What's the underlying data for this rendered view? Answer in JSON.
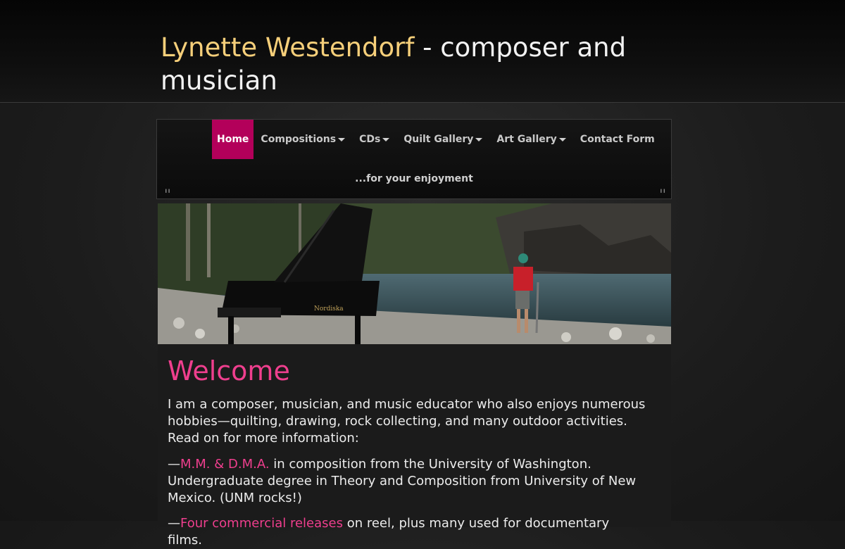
{
  "header": {
    "name": "Lynette Westendorf",
    "rest": " - composer and musician"
  },
  "nav": {
    "items": [
      {
        "label": "Home",
        "dropdown": false,
        "active": true
      },
      {
        "label": "Compositions",
        "dropdown": true
      },
      {
        "label": "CDs",
        "dropdown": true
      },
      {
        "label": "Quilt Gallery",
        "dropdown": true
      },
      {
        "label": "Art Gallery",
        "dropdown": true
      },
      {
        "label": "Contact Form",
        "dropdown": false
      }
    ],
    "sub_item": "...for your enjoyment"
  },
  "hero": {
    "piano_brand": "Nordiska"
  },
  "main": {
    "heading": "Welcome",
    "para1": "I am a composer, musician, and music educator who also enjoys numerous hobbies—quilting, drawing, rock collecting, and many outdoor activities. Read on for more information:",
    "para2_prefix": "—",
    "para2_link": "M.M. & D.M.A.",
    "para2_rest": " in composition from the University of Washington. Undergraduate degree in Theory and Composition from University of New Mexico. (UNM rocks!)",
    "para3_prefix": "—",
    "para3_link": "Four commercial releases",
    "para3_rest": " on reel, plus many used for documentary films."
  },
  "colors": {
    "accent": "#ef3f8e",
    "nav_active": "#b3005a",
    "title_name": "#f6cf7a"
  }
}
